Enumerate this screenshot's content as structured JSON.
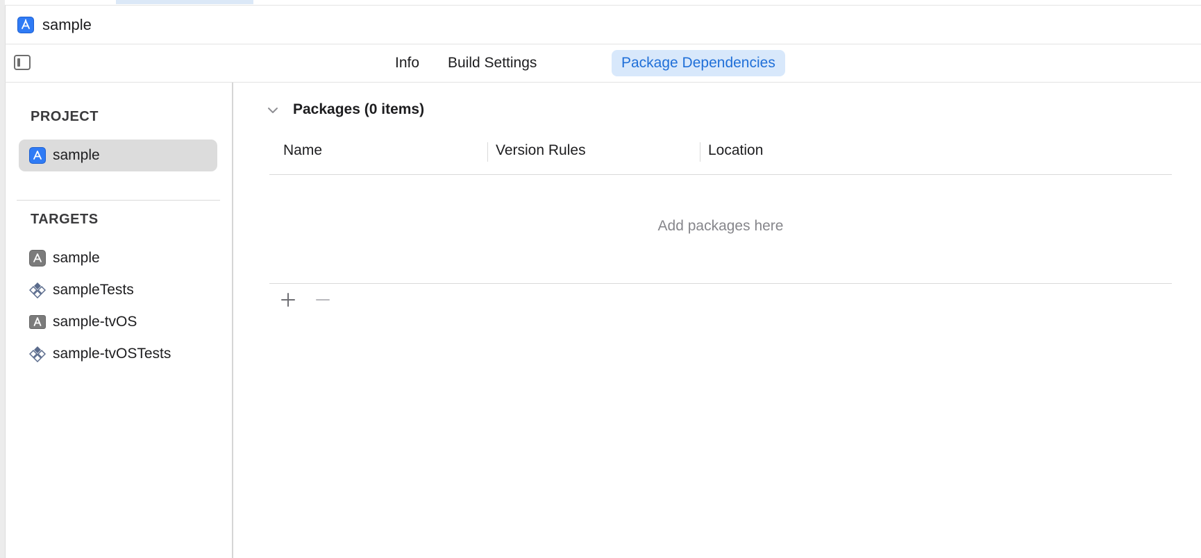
{
  "window": {
    "jump_bar_title": "sample"
  },
  "tabs": [
    {
      "label": "Info"
    },
    {
      "label": "Build Settings"
    },
    {
      "label": "Package Dependencies",
      "active": true
    }
  ],
  "sidebar": {
    "project_section_title": "PROJECT",
    "project_items": [
      {
        "label": "sample",
        "icon": "app-icon",
        "selected": true
      }
    ],
    "targets_section_title": "TARGETS",
    "target_items": [
      {
        "label": "sample",
        "icon": "app-target-icon"
      },
      {
        "label": "sampleTests",
        "icon": "test-bundle-icon"
      },
      {
        "label": "sample-tvOS",
        "icon": "tv-target-icon"
      },
      {
        "label": "sample-tvOSTests",
        "icon": "test-bundle-icon"
      }
    ]
  },
  "packages": {
    "heading": "Packages (0 items)",
    "columns": [
      "Name",
      "Version Rules",
      "Location"
    ],
    "empty_message": "Add packages here",
    "add_icon": "plus-icon",
    "remove_icon": "minus-icon"
  },
  "colors": {
    "accent": "#1f6fd8",
    "active_tab_bg": "#d8e8fb",
    "selected_row_bg": "#dcdcdc",
    "app_icon_blue": "#2f7bf5"
  }
}
